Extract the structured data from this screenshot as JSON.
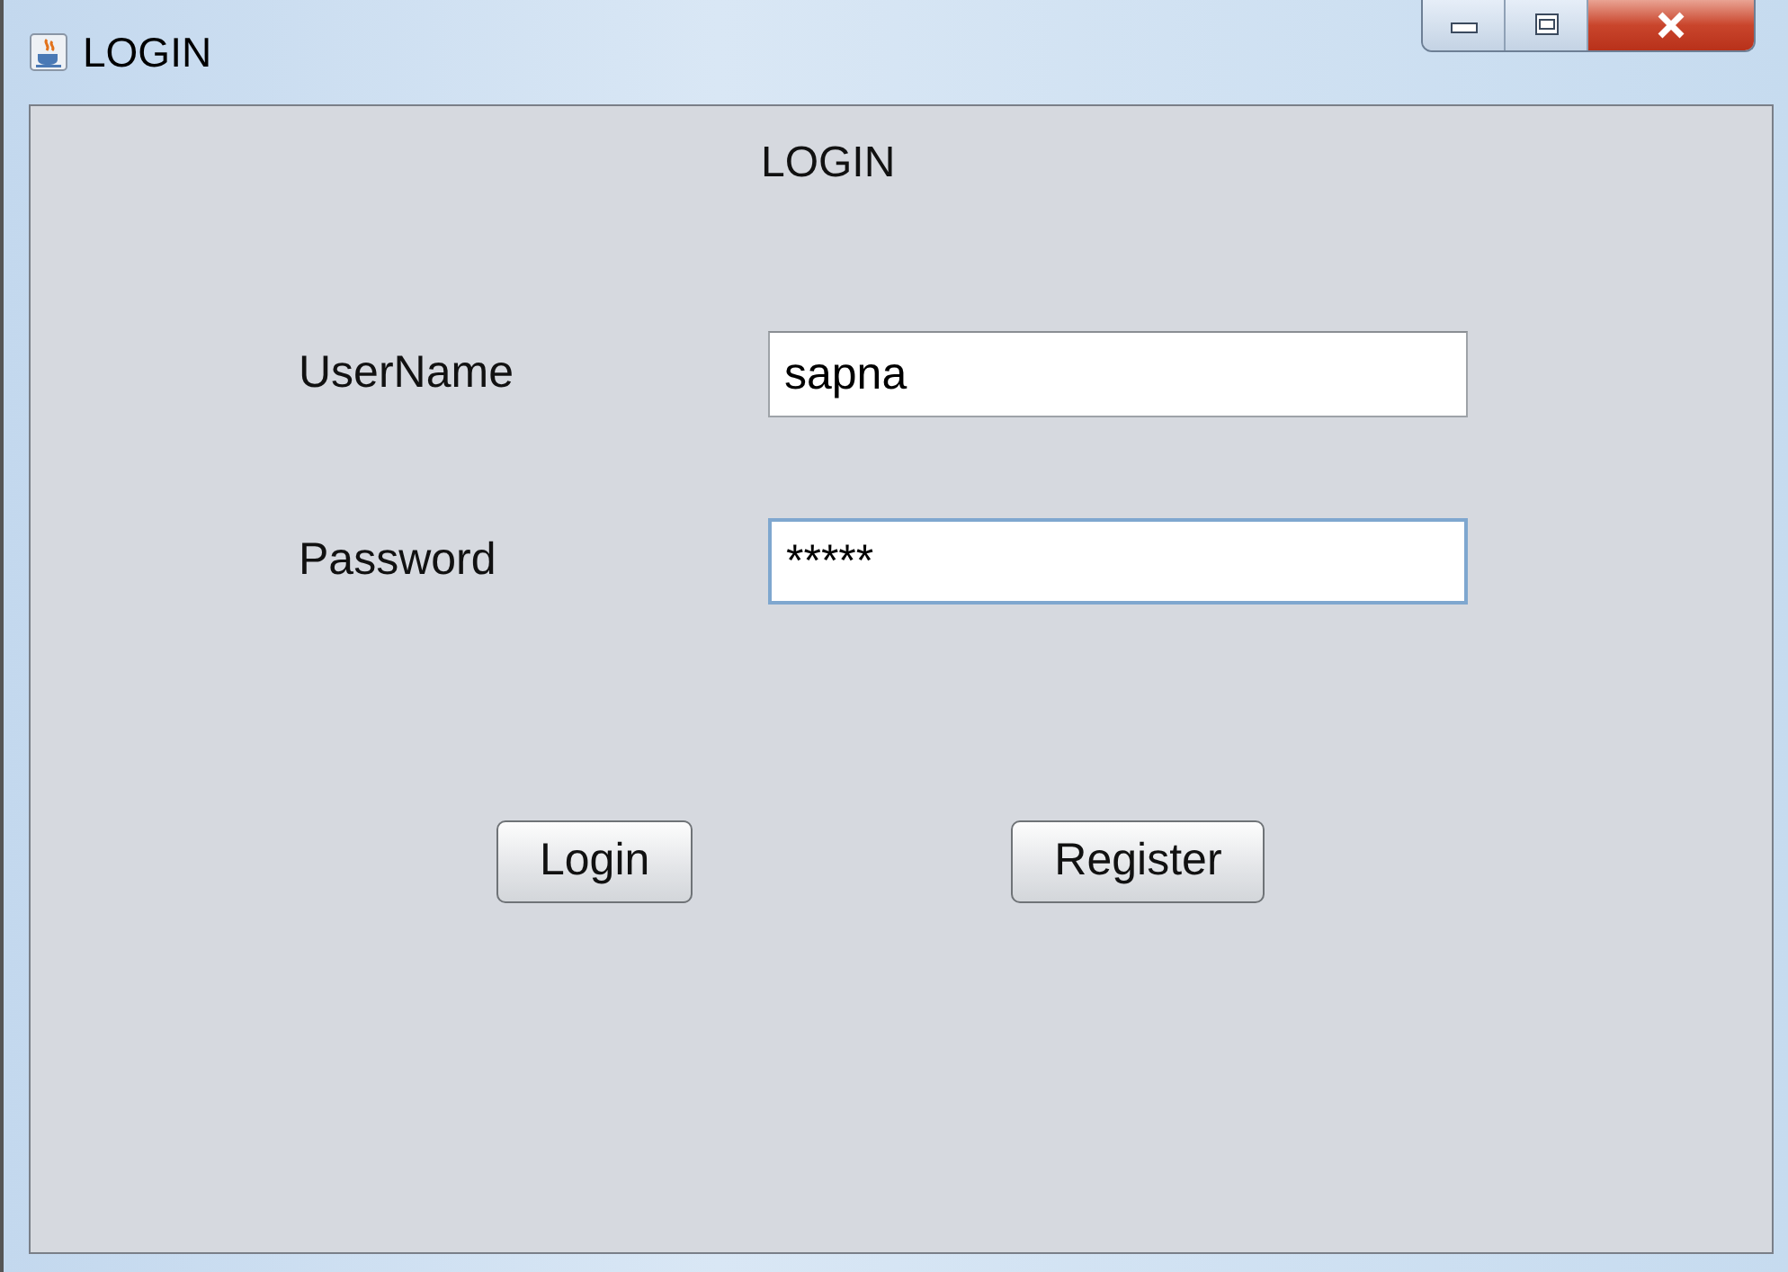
{
  "window": {
    "title": "LOGIN"
  },
  "heading": "LOGIN",
  "fields": [
    {
      "label": "UserName",
      "value": "sapna",
      "focused": false
    },
    {
      "label": "Password",
      "value": "*****",
      "focused": true
    }
  ],
  "buttons": [
    "Login",
    "Register"
  ]
}
